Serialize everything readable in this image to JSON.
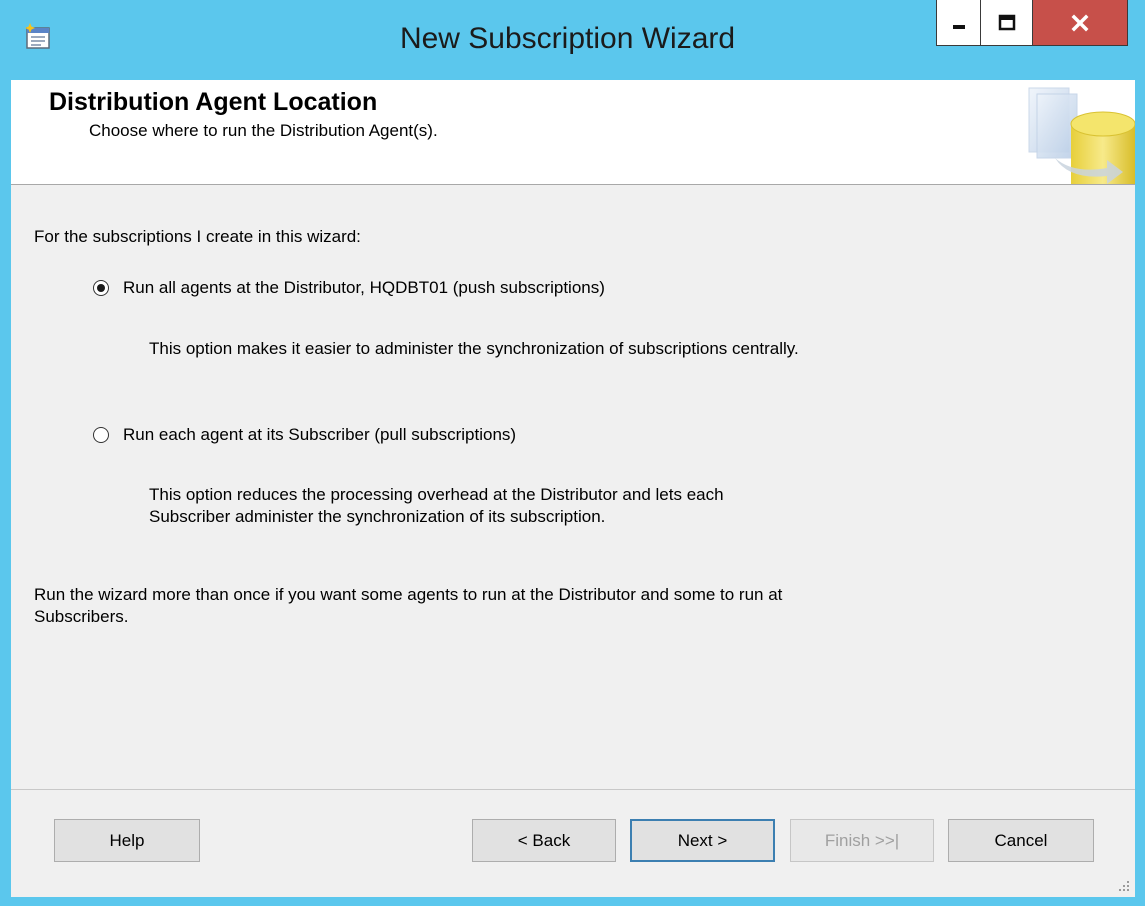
{
  "window": {
    "title": "New Subscription Wizard"
  },
  "header": {
    "title": "Distribution Agent Location",
    "subtitle": "Choose where to run the Distribution Agent(s)."
  },
  "content": {
    "intro": "For the subscriptions I create in this wizard:",
    "options": [
      {
        "label": "Run all agents at the Distributor, HQDBT01 (push subscriptions)",
        "checked": true,
        "description_lines": [
          "This option makes it easier to administer the synchronization of subscriptions centrally."
        ]
      },
      {
        "label": "Run each agent at its Subscriber (pull subscriptions)",
        "checked": false,
        "description_lines": [
          "This option reduces the processing overhead at the Distributor and lets each",
          "Subscriber administer the synchronization of its subscription."
        ]
      }
    ],
    "note_lines": [
      "Run the wizard more than once if you want some agents to run at the Distributor and some to run at",
      "Subscribers."
    ]
  },
  "footer": {
    "help": "Help",
    "back": "< Back",
    "next": "Next >",
    "finish": "Finish >>|",
    "cancel": "Cancel"
  },
  "icons": {
    "app": "wizard-window-icon",
    "header": "database-graphic-icon",
    "minimize": "minimize-icon",
    "maximize": "maximize-icon",
    "close": "close-icon",
    "grip": "resize-grip-icon"
  },
  "colors": {
    "titlebar": "#5bc7ed",
    "close_button": "#c7504a",
    "client_background": "#f0f0f0",
    "default_button_border": "#3c7fb1"
  }
}
